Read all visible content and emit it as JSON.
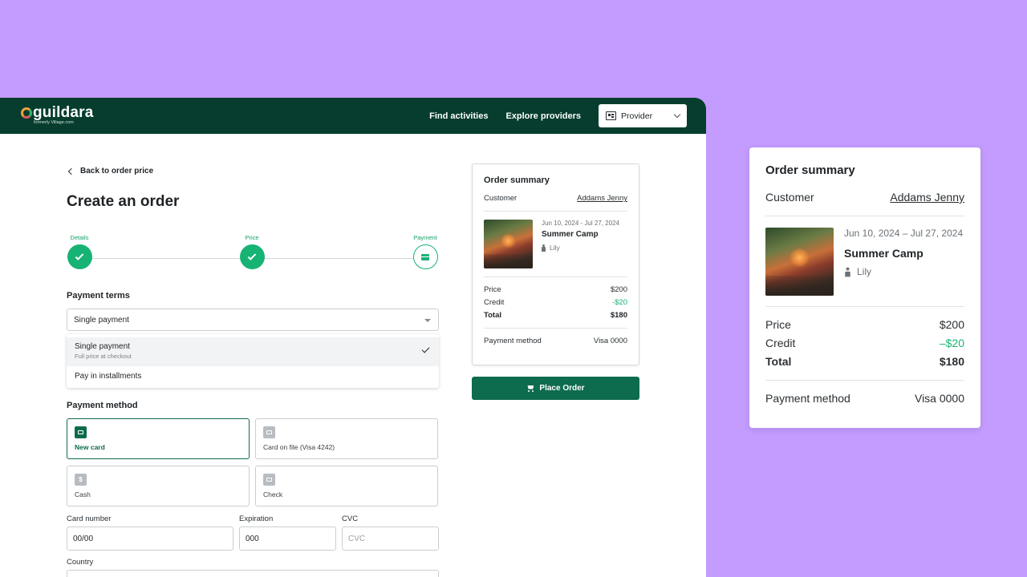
{
  "nav": {
    "logo_text": "guildara",
    "logo_sub": "formerly Village.com",
    "links": [
      "Find activities",
      "Explore providers"
    ],
    "provider_select": "Provider"
  },
  "form": {
    "back_label": "Back to order price",
    "title": "Create an order",
    "steps": [
      "Details",
      "Price",
      "Payment"
    ],
    "payment_terms_label": "Payment terms",
    "payment_terms_value": "Single payment",
    "options": [
      {
        "title": "Single payment",
        "subtitle": "Full price at checkout"
      },
      {
        "title": "Pay in installments"
      }
    ],
    "payment_method_label": "Payment method",
    "methods": [
      {
        "label": "New card",
        "icon": "card-icon"
      },
      {
        "label": "Card on file (Visa 4242)",
        "icon": "card-icon"
      },
      {
        "label": "Cash",
        "icon": "dollar-icon",
        "glyph": "$"
      },
      {
        "label": "Check",
        "icon": "check-icon"
      }
    ],
    "card_number_label": "Card number",
    "card_number_value": "00/00",
    "expiration_label": "Expiration",
    "expiration_value": "000",
    "cvc_label": "CVC",
    "cvc_placeholder": "CVC",
    "country_label": "Country"
  },
  "summary": {
    "title": "Order summary",
    "customer_label": "Customer",
    "customer_name": "Addams Jenny",
    "camp_dates_small": "Jun 10, 2024 - Jul 27, 2024",
    "camp_dates_large": "Jun 10, 2024 – Jul 27, 2024",
    "camp_name": "Summer Camp",
    "camper": "Lily",
    "price_label": "Price",
    "price_value": "$200",
    "credit_label": "Credit",
    "credit_value": "-$20",
    "credit_value_large": "–$20",
    "total_label": "Total",
    "total_value": "$180",
    "payment_method_label": "Payment method",
    "payment_method_value": "Visa 0000"
  },
  "place_order_label": "Place Order",
  "colors": {
    "background": "#c49bff",
    "nav": "#063d2e",
    "accent": "#0d6b4e",
    "success": "#17b374"
  }
}
